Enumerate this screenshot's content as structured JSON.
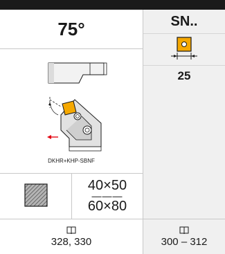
{
  "header": {
    "angle": "75°",
    "insert_type": "SN.."
  },
  "diagram": {
    "label": "DKHR+KHP-SBNF"
  },
  "insert_size": "25",
  "shank": {
    "size_small": "40×50",
    "separator": "———",
    "size_large": "60×80"
  },
  "references": {
    "left_pages": "328, 330",
    "right_pages": "300 – 312",
    "book_icon": "book-icon"
  },
  "colors": {
    "top_bar": "#1a1a1a",
    "insert_orange": "#f5a800",
    "highlight_red": "#e30613",
    "grid_line": "#c8c8c8",
    "right_column_bg": "#f0f0f0"
  }
}
